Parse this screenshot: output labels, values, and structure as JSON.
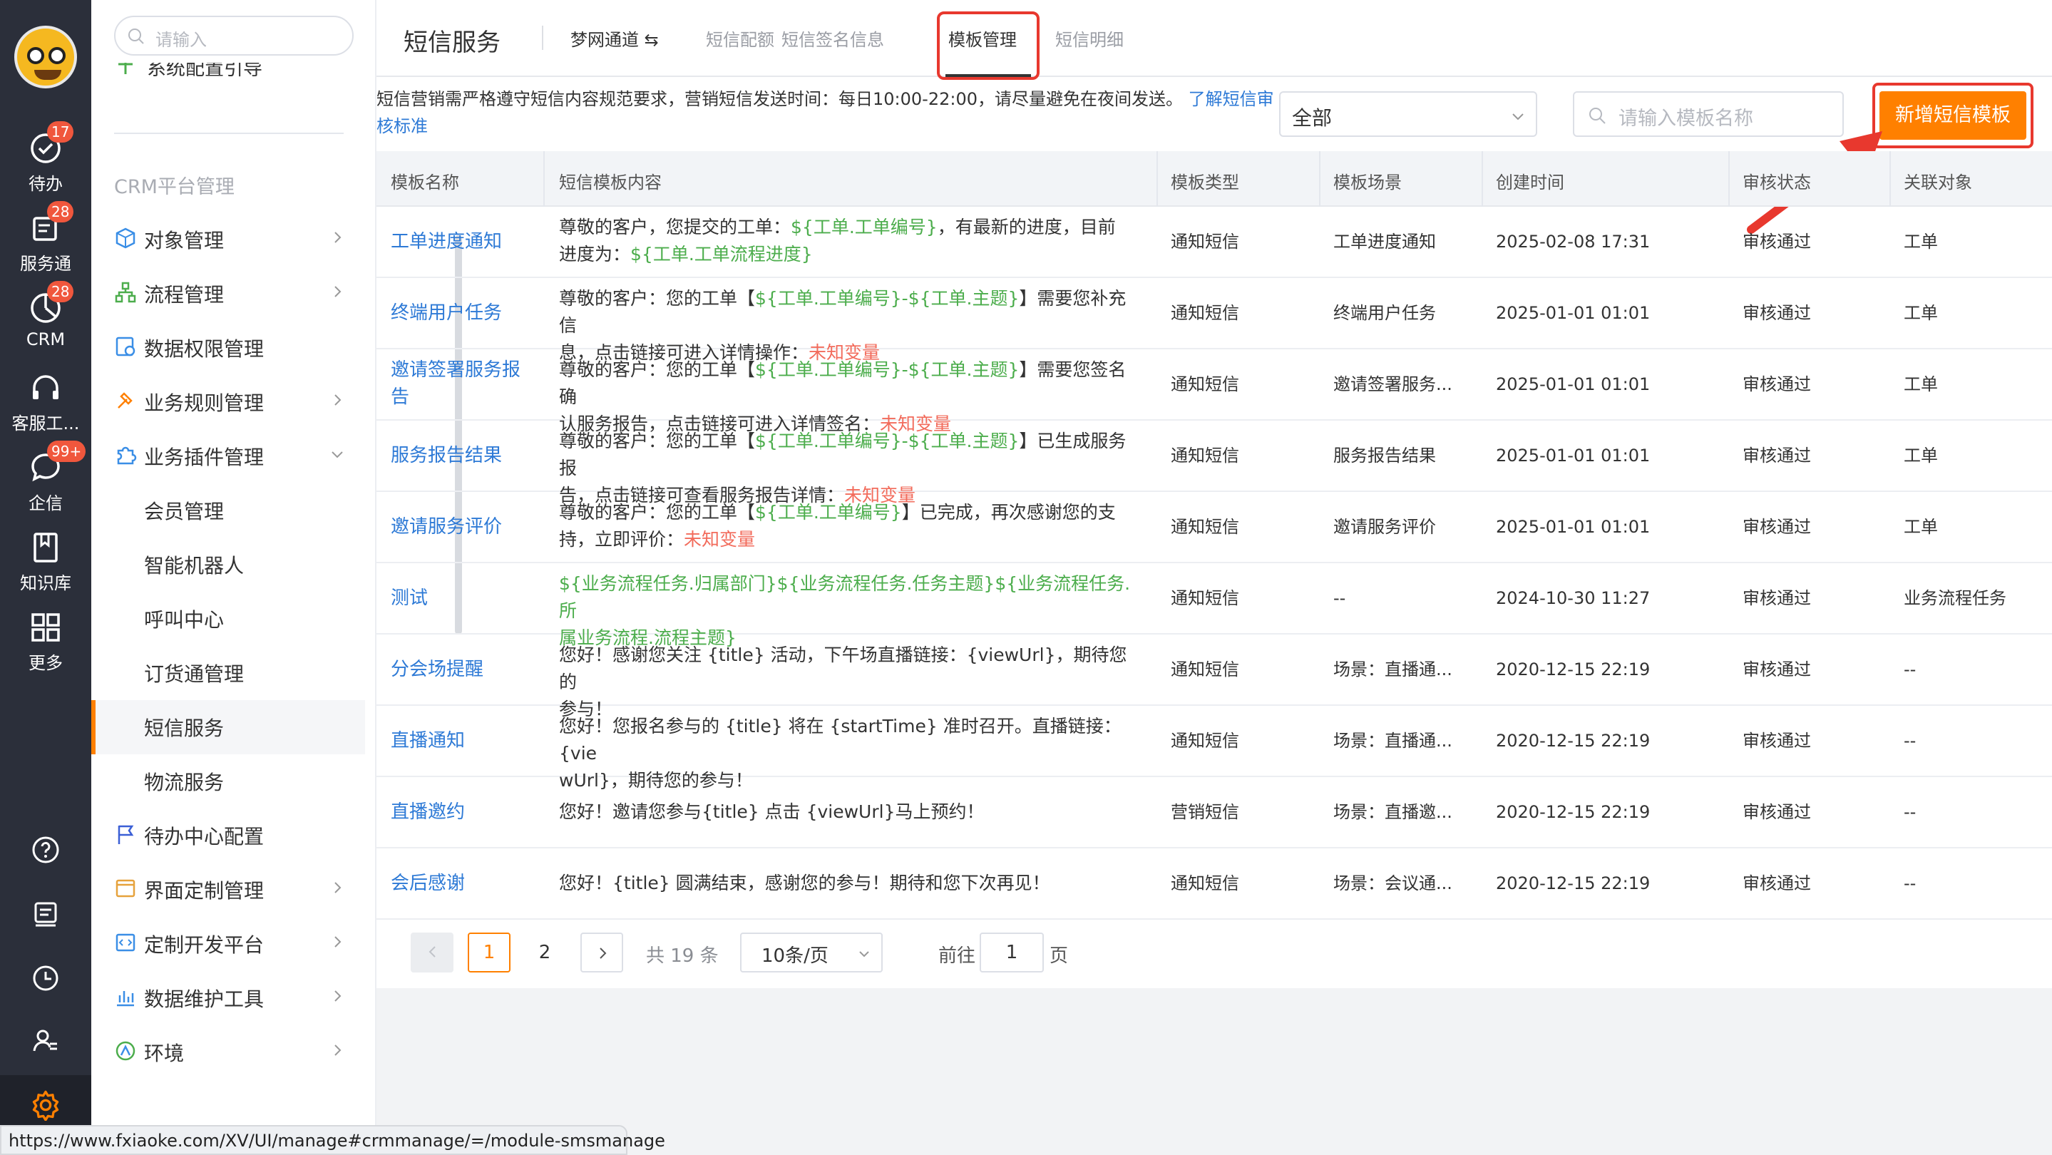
{
  "rail": {
    "items": [
      {
        "label": "待办",
        "badge": "17"
      },
      {
        "label": "服务通",
        "badge": "28"
      },
      {
        "label": "CRM",
        "badge": "28"
      },
      {
        "label": "客服工...",
        "badge": ""
      },
      {
        "label": "企信",
        "badge": "99+"
      },
      {
        "label": "知识库",
        "badge": ""
      },
      {
        "label": "更多",
        "badge": ""
      }
    ],
    "bottom_icons": [
      "help-icon",
      "notes-icon",
      "clock-icon",
      "contacts-icon"
    ],
    "gear_icon": "gear-icon",
    "accent": "#ff8000"
  },
  "menu": {
    "search_placeholder": "请输入",
    "cut_item": "系统配置引导",
    "section": "CRM平台管理",
    "items": [
      {
        "label": "对象管理",
        "has_arrow": true,
        "icon": "cube-icon"
      },
      {
        "label": "流程管理",
        "has_arrow": true,
        "icon": "flow-icon"
      },
      {
        "label": "数据权限管理",
        "has_arrow": false,
        "icon": "permission-icon"
      },
      {
        "label": "业务规则管理",
        "has_arrow": true,
        "icon": "rule-icon"
      },
      {
        "label": "业务插件管理",
        "has_arrow": true,
        "expanded": true,
        "icon": "plugin-icon"
      },
      {
        "label": "会员管理",
        "sub": true
      },
      {
        "label": "智能机器人",
        "sub": true
      },
      {
        "label": "呼叫中心",
        "sub": true
      },
      {
        "label": "订货通管理",
        "sub": true
      },
      {
        "label": "短信服务",
        "sub": true,
        "active": true
      },
      {
        "label": "物流服务",
        "sub": true
      },
      {
        "label": "待办中心配置",
        "has_arrow": false,
        "icon": "flag-icon"
      },
      {
        "label": "界面定制管理",
        "has_arrow": true,
        "icon": "layout-icon"
      },
      {
        "label": "定制开发平台",
        "has_arrow": true,
        "icon": "code-icon"
      },
      {
        "label": "数据维护工具",
        "has_arrow": true,
        "icon": "chart-icon"
      },
      {
        "label": "环境",
        "has_arrow": true,
        "icon": "environment-icon"
      }
    ]
  },
  "header": {
    "title": "短信服务",
    "tabs": [
      {
        "label": "梦网通道 ⇆",
        "state": "dark"
      },
      {
        "label": "短信配额",
        "state": "muted"
      },
      {
        "label": "短信签名信息",
        "state": "muted"
      },
      {
        "label": "模板管理",
        "state": "active"
      },
      {
        "label": "短信明细",
        "state": "muted"
      }
    ]
  },
  "toolbar": {
    "notice": "短信营销需严格遵守短信内容规范要求，营销短信发送时间：每日10:00-22:00，请尽量避免在夜间发送。",
    "notice_link_1": "了解短信审",
    "notice_link_2": "核标准",
    "filter_value": "全部",
    "search_placeholder": "请输入模板名称",
    "new_button": "新增短信模板"
  },
  "table": {
    "columns": [
      "模板名称",
      "短信模板内容",
      "模板类型",
      "模板场景",
      "创建时间",
      "审核状态",
      "关联对象"
    ],
    "rows": [
      {
        "name": [
          "工单进度通知"
        ],
        "content": [
          [
            [
              "t",
              "尊敬的客户，您提交的工单："
            ],
            [
              "g",
              "${工单.工单编号}"
            ],
            [
              "t",
              "，有最新的进度，目前"
            ]
          ],
          [
            [
              "t",
              "进度为："
            ],
            [
              "g",
              "${工单.工单流程进度}"
            ]
          ]
        ],
        "type": "通知短信",
        "scene": "工单进度通知",
        "time": "2025-02-08 17:31",
        "status": "审核通过",
        "related": "工单"
      },
      {
        "name": [
          "终端用户任务"
        ],
        "content": [
          [
            [
              "t",
              "尊敬的客户：您的工单【"
            ],
            [
              "g",
              "${工单.工单编号}-${工单.主题}"
            ],
            [
              "t",
              "】需要您补充信"
            ]
          ],
          [
            [
              "t",
              "息，点击链接可进入详情操作："
            ],
            [
              "r",
              "未知变量"
            ]
          ]
        ],
        "type": "通知短信",
        "scene": "终端用户任务",
        "time": "2025-01-01 01:01",
        "status": "审核通过",
        "related": "工单"
      },
      {
        "name": [
          "邀请签署服务报",
          "告"
        ],
        "content": [
          [
            [
              "t",
              "尊敬的客户：您的工单【"
            ],
            [
              "g",
              "${工单.工单编号}-${工单.主题}"
            ],
            [
              "t",
              "】需要您签名确"
            ]
          ],
          [
            [
              "t",
              "认服务报告，点击链接可进入详情签名："
            ],
            [
              "r",
              "未知变量"
            ]
          ]
        ],
        "type": "通知短信",
        "scene": "邀请签署服务...",
        "time": "2025-01-01 01:01",
        "status": "审核通过",
        "related": "工单"
      },
      {
        "name": [
          "服务报告结果"
        ],
        "content": [
          [
            [
              "t",
              "尊敬的客户：您的工单【"
            ],
            [
              "g",
              "${工单.工单编号}-${工单.主题}"
            ],
            [
              "t",
              "】已生成服务报"
            ]
          ],
          [
            [
              "t",
              "告，点击链接可查看服务报告详情："
            ],
            [
              "r",
              "未知变量"
            ]
          ]
        ],
        "type": "通知短信",
        "scene": "服务报告结果",
        "time": "2025-01-01 01:01",
        "status": "审核通过",
        "related": "工单"
      },
      {
        "name": [
          "邀请服务评价"
        ],
        "content": [
          [
            [
              "t",
              "尊敬的客户：您的工单【"
            ],
            [
              "g",
              "${工单.工单编号}"
            ],
            [
              "t",
              "】已完成，再次感谢您的支"
            ]
          ],
          [
            [
              "t",
              "持，立即评价："
            ],
            [
              "r",
              "未知变量"
            ]
          ]
        ],
        "type": "通知短信",
        "scene": "邀请服务评价",
        "time": "2025-01-01 01:01",
        "status": "审核通过",
        "related": "工单"
      },
      {
        "name": [
          "测试"
        ],
        "content": [
          [
            [
              "g",
              "${业务流程任务.归属部门}${业务流程任务.任务主题}${业务流程任务.所"
            ]
          ],
          [
            [
              "g",
              "属业务流程.流程主题}"
            ]
          ]
        ],
        "type": "通知短信",
        "scene": "--",
        "time": "2024-10-30 11:27",
        "status": "审核通过",
        "related": "业务流程任务"
      },
      {
        "name": [
          "分会场提醒"
        ],
        "content": [
          [
            [
              "t",
              "您好！感谢您关注 {title} 活动，下午场直播链接：{viewUrl}，期待您的"
            ]
          ],
          [
            [
              "t",
              "参与！"
            ]
          ]
        ],
        "type": "通知短信",
        "scene": "场景：直播通...",
        "time": "2020-12-15 22:19",
        "status": "审核通过",
        "related": "--"
      },
      {
        "name": [
          "直播通知"
        ],
        "content": [
          [
            [
              "t",
              "您好！您报名参与的 {title} 将在 {startTime} 准时召开。直播链接：{vie"
            ]
          ],
          [
            [
              "t",
              "wUrl}，期待您的参与！"
            ]
          ]
        ],
        "type": "通知短信",
        "scene": "场景：直播通...",
        "time": "2020-12-15 22:19",
        "status": "审核通过",
        "related": "--"
      },
      {
        "name": [
          "直播邀约"
        ],
        "content": [
          [
            [
              "t",
              "您好！邀请您参与{title} 点击 {viewUrl}马上预约！"
            ]
          ]
        ],
        "type": "营销短信",
        "scene": "场景：直播邀...",
        "time": "2020-12-15 22:19",
        "status": "审核通过",
        "related": "--"
      },
      {
        "name": [
          "会后感谢"
        ],
        "content": [
          [
            [
              "t",
              "您好！{title} 圆满结束，感谢您的参与！期待和您下次再见！"
            ]
          ]
        ],
        "type": "通知短信",
        "scene": "场景：会议通...",
        "time": "2020-12-15 22:19",
        "status": "审核通过",
        "related": "--"
      }
    ]
  },
  "pagination": {
    "prev": "‹",
    "current": "1",
    "page2": "2",
    "next": "›",
    "total": "共 19 条",
    "page_size": "10条/页",
    "goto_label": "前往",
    "goto_value": "1",
    "goto_suffix": "页"
  },
  "statusbar": {
    "url": "https://www.fxiaoke.com/XV/UI/manage#crmmanage/=/module-smsmanage"
  },
  "colors": {
    "link": "#2e7ad6",
    "variable": "#4cad4c",
    "unknown": "#f26b5b",
    "highlight": "#e8382e"
  }
}
